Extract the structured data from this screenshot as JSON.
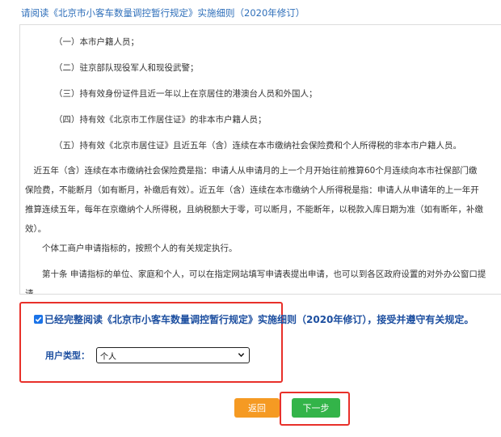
{
  "header": {
    "title": "请阅读《北京市小客车数量调控暂行规定》实施细则（2020年修订）"
  },
  "content": {
    "items": [
      "（一）本市户籍人员；",
      "（二）驻京部队现役军人和现役武警；",
      "（三）持有效身份证件且近一年以上在京居住的港澳台人员和外国人；",
      "（四）持有效《北京市工作居住证》的非本市户籍人员；",
      "（五）持有效《北京市居住证》且近五年（含）连续在本市缴纳社会保险费和个人所得税的非本市户籍人员。"
    ],
    "para1": [
      "　近五年（含）连续在本市缴纳社会保险费是指：申请人从申请月的上一个月开始往前推算60个月连续向本市社保部门缴",
      "保险费，不能断月（如有断月，补缴后有效）。近五年（含）连续在本市缴纳个人所得税是指：申请人从申请年的上一年开",
      "推算连续五年，每年在京缴纳个人所得税，且纳税额大于零，可以断月，不能断年，以税款入库日期为准（如有断年，补缴",
      "效）。"
    ],
    "para2": "　　个体工商户申请指标的，按照个人的有关规定执行。",
    "para3": "　　第十条 申请指标的单位、家庭和个人，可以在指定网站填写申请表提出申请，也可以到各区政府设置的对外办公窗口提",
    "para3_cut": "请"
  },
  "agreement": {
    "checked": true,
    "text": "已经完整阅读《北京市小客车数量调控暂行规定》实施细则（2020年修订），接受并遵守有关规定。"
  },
  "user_type": {
    "label": "用户类型：",
    "selected": "个人"
  },
  "buttons": {
    "back": "返回",
    "next": "下一步"
  },
  "colors": {
    "title": "#2f6fba",
    "agree_text": "#1d4fa0",
    "back_button": "#f59a23",
    "next_button": "#33b449",
    "highlight_border": "#e8302a"
  }
}
